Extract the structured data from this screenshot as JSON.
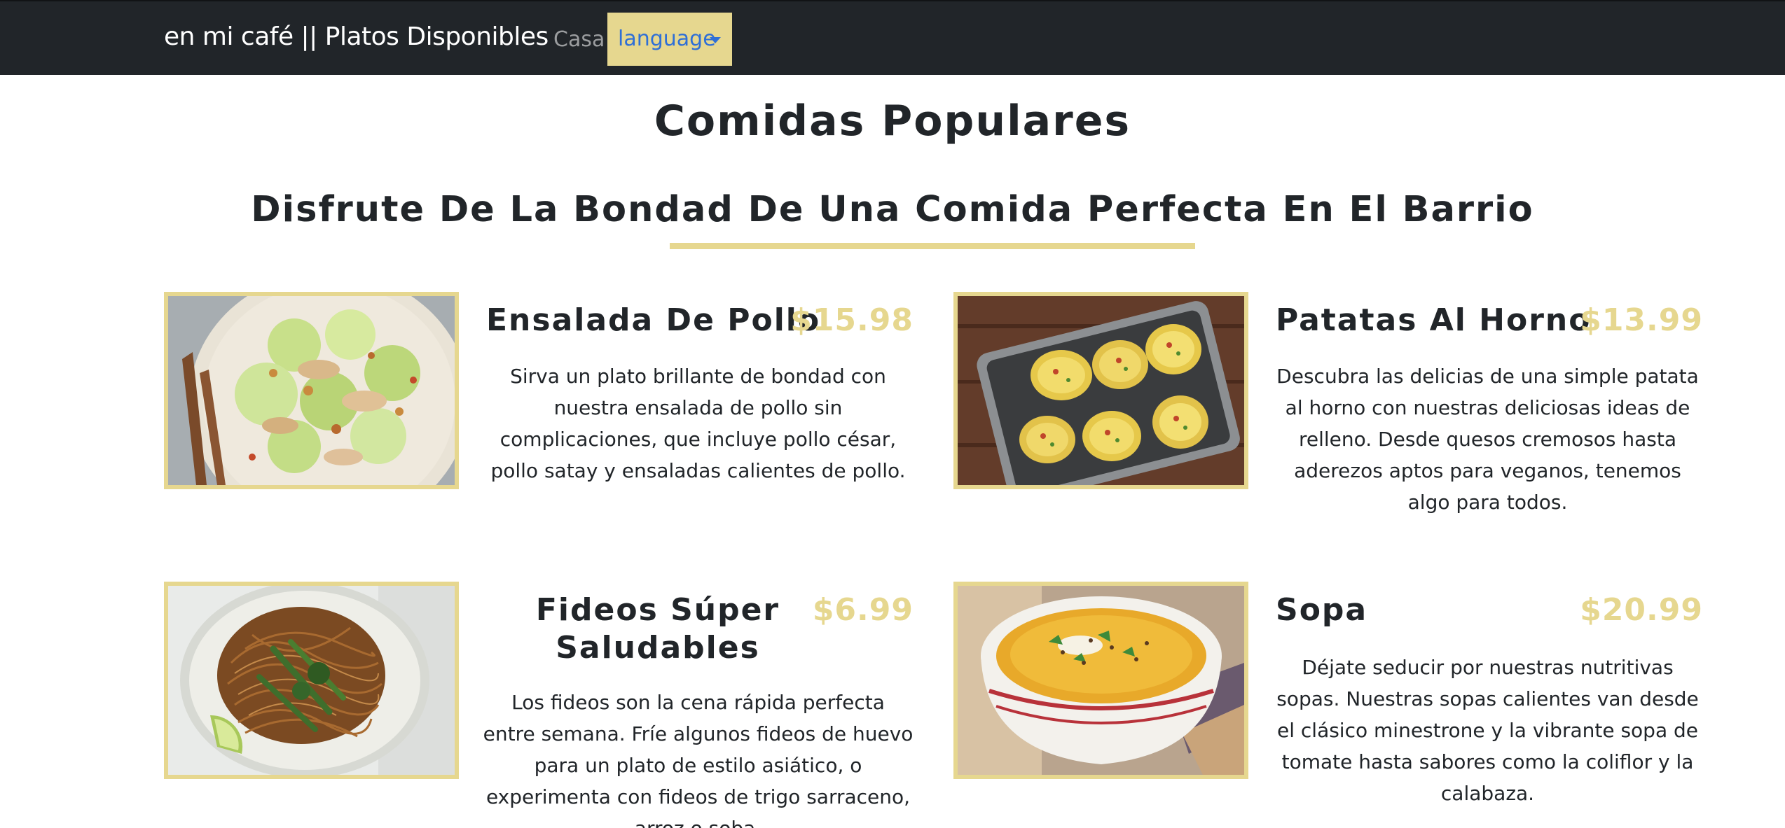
{
  "navbar": {
    "brand": "en mi café || Platos Disponibles",
    "home_link": "Casa",
    "language_dropdown": "language"
  },
  "main": {
    "title": "Comidas Populares",
    "subtitle": "Disfrute De La Bondad De Una Comida Perfecta En El Barrio"
  },
  "dishes": [
    {
      "name": "Ensalada De Pollo",
      "price": "$15.98",
      "description": "Sirva un plato brillante de bondad con nuestra ensalada de pollo sin complicaciones, que incluye pollo césar, pollo satay y ensaladas calientes de pollo."
    },
    {
      "name": "Patatas Al Horno",
      "price": "$13.99",
      "description": "Descubra las delicias de una simple patata al horno con nuestras deliciosas ideas de relleno. Desde quesos cremosos hasta aderezos aptos para veganos, tenemos algo para todos."
    },
    {
      "name": "Fideos Súper Saludables",
      "price": "$6.99",
      "description": "Los fideos son la cena rápida perfecta entre semana. Fríe algunos fideos de huevo para un plato de estilo asiático, o experimenta con fideos de trigo sarraceno, arroz o soba."
    },
    {
      "name": "Sopa",
      "price": "$20.99",
      "description": "Déjate seducir por nuestras nutritivas sopas. Nuestras sopas calientes van desde el clásico minestrone y la vibrante sopa de tomate hasta sabores como la coliflor y la calabaza."
    }
  ],
  "colors": {
    "navbar_bg": "#212529",
    "accent_gold": "#e6d78f",
    "link_blue": "#2f6fd6",
    "text_dark": "#212529"
  },
  "icons": {
    "dropdown": "caret-down-icon"
  }
}
